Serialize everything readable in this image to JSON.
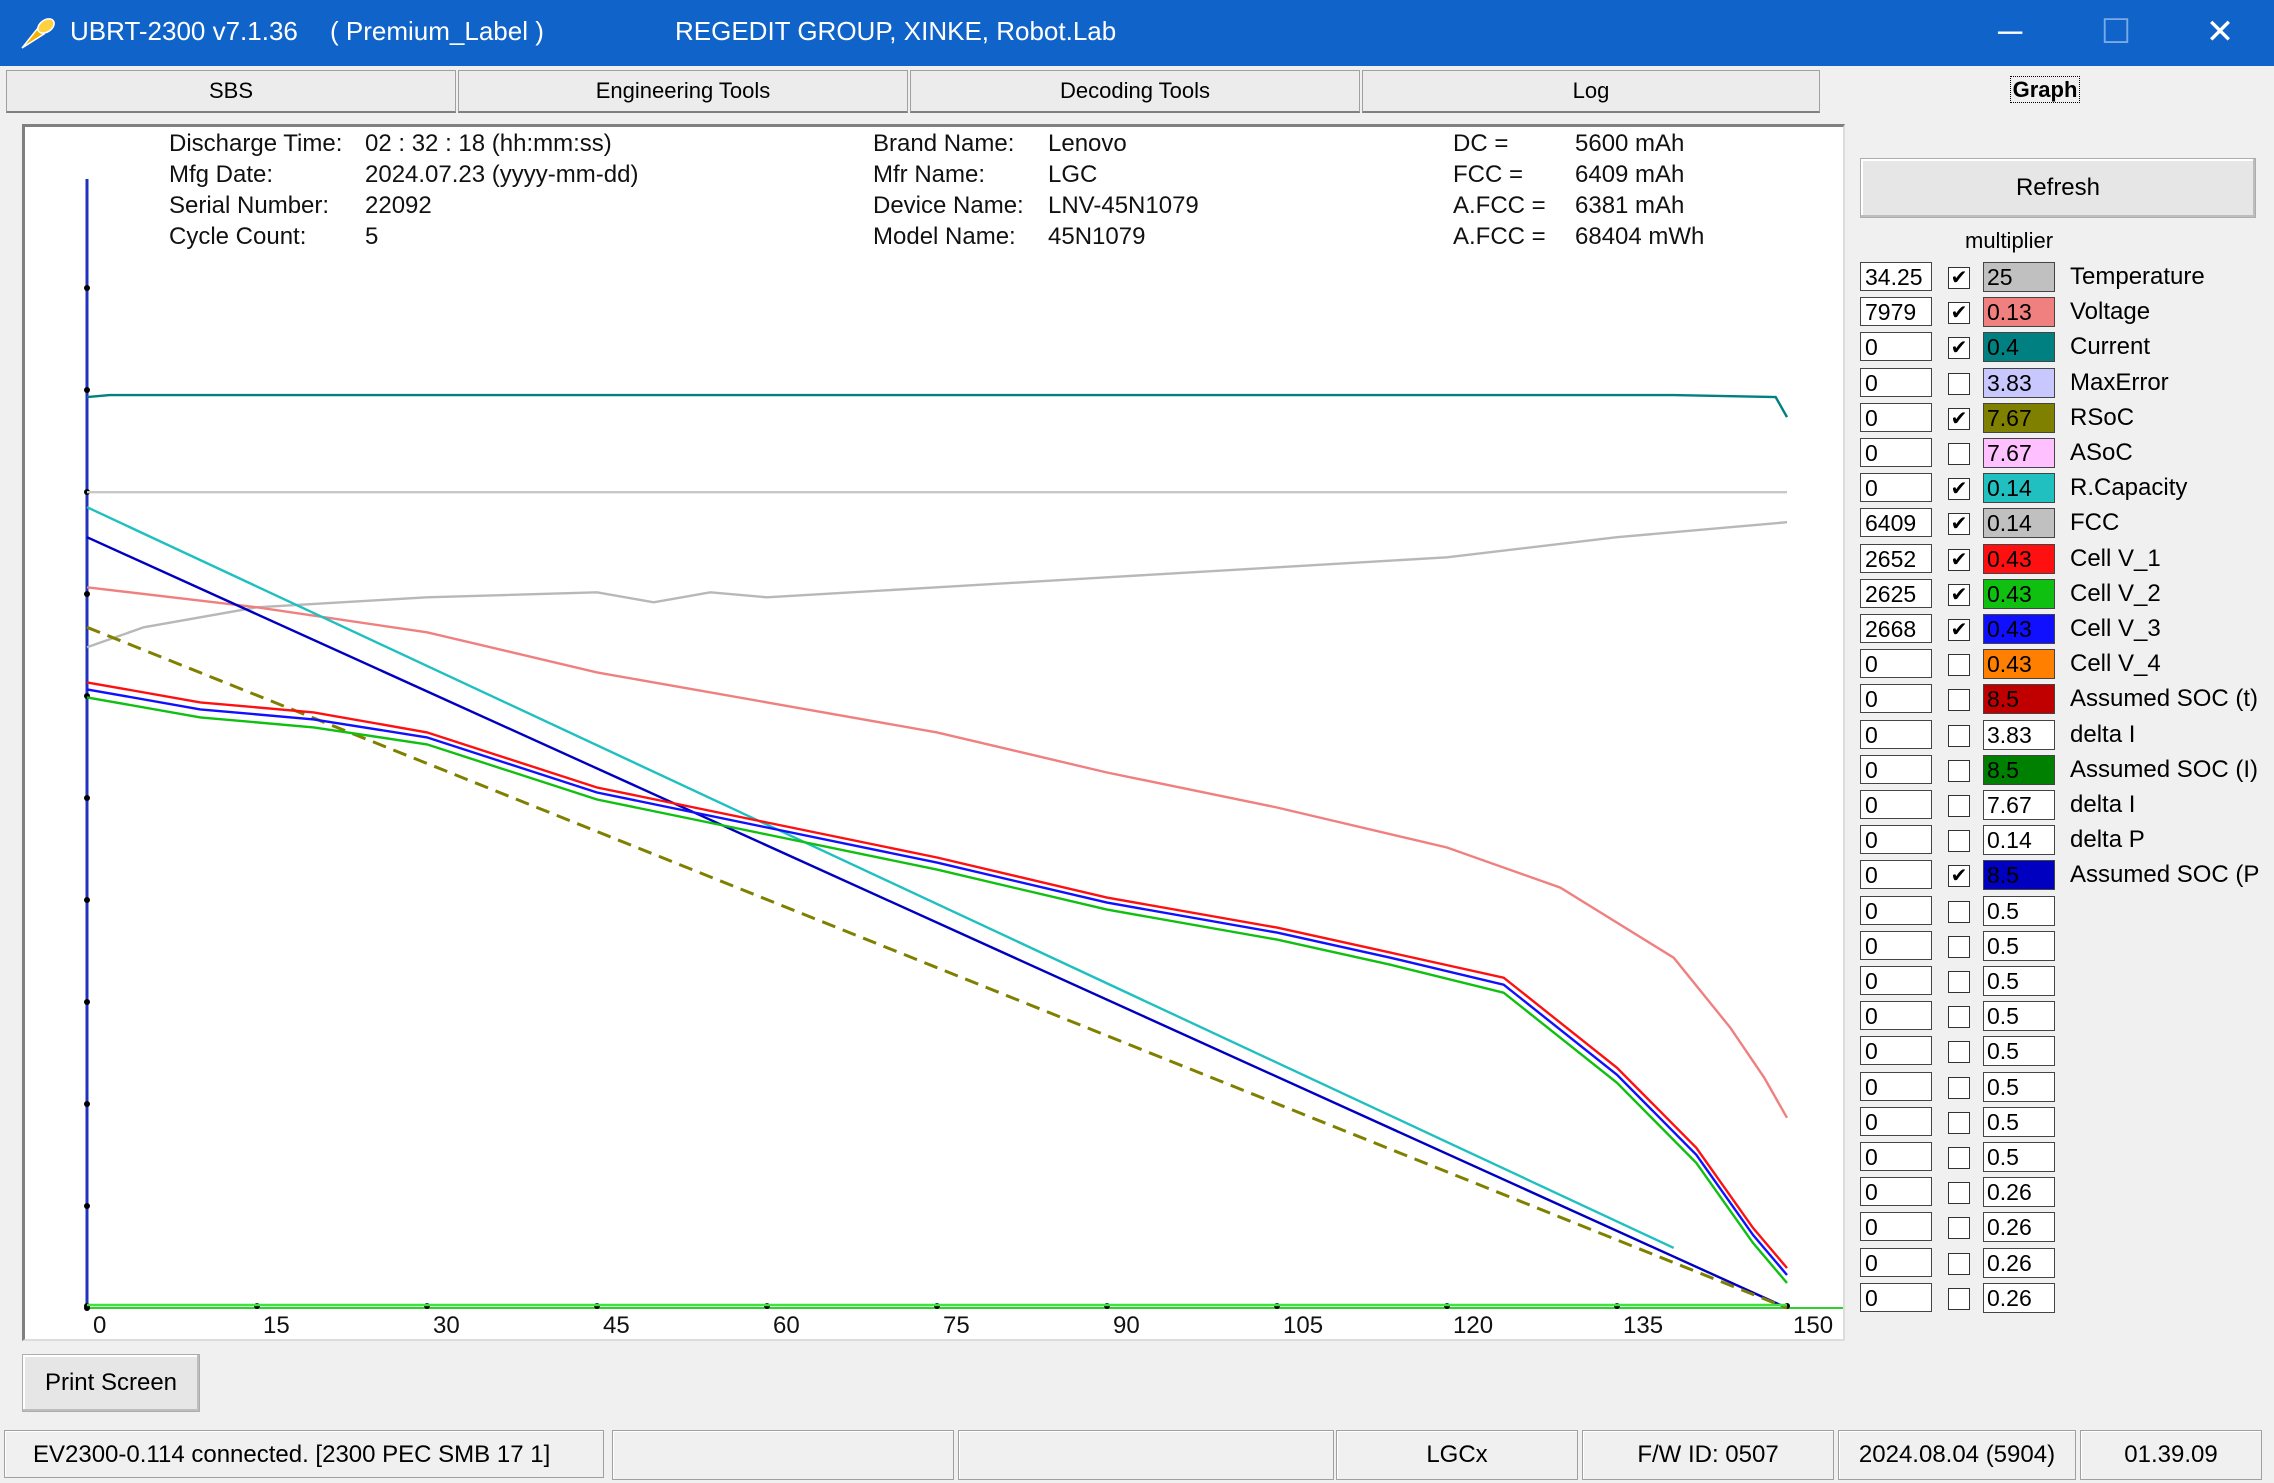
{
  "window": {
    "app_name": "UBRT-2300 v7.1.36",
    "label": "( Premium_Label )",
    "company": "REGEDIT GROUP,  XINKE,  Robot.Lab",
    "minimize": "─",
    "maximize": "☐",
    "close": "✕"
  },
  "tabs": [
    {
      "label": "SBS"
    },
    {
      "label": "Engineering Tools"
    },
    {
      "label": "Decoding Tools"
    },
    {
      "label": "Log"
    },
    {
      "label": "Graph"
    }
  ],
  "info": {
    "discharge_time_label": "Discharge Time:",
    "discharge_time_value": "02 : 32 : 18 (hh:mm:ss)",
    "mfg_date_label": "Mfg Date:",
    "mfg_date_value": "2024.07.23 (yyyy-mm-dd)",
    "serial_label": "Serial Number:",
    "serial_value": "22092",
    "cycle_label": "Cycle Count:",
    "cycle_value": "5",
    "brand_label": "Brand Name:",
    "brand_value": "Lenovo",
    "mfr_label": "Mfr Name:",
    "mfr_value": "LGC",
    "device_label": "Device Name:",
    "device_value": "LNV-45N1079",
    "model_label": "Model Name:",
    "model_value": "45N1079",
    "dc_label": "DC =",
    "dc_value": "5600 mAh",
    "fcc_label": "FCC =",
    "fcc_value": "6409 mAh",
    "afcc_label": "A.FCC =",
    "afcc_value": "6381 mAh",
    "afcc2_label": "A.FCC =",
    "afcc2_value": "68404 mWh"
  },
  "x_ticks": [
    "0",
    "15",
    "30",
    "45",
    "60",
    "75",
    "90",
    "105",
    "120",
    "135",
    "150"
  ],
  "buttons": {
    "refresh": "Refresh",
    "print_screen": "Print Screen"
  },
  "multiplier_label": "multiplier",
  "channels": [
    {
      "value": "34.25",
      "checked": true,
      "multiplier": "25",
      "color": "#c0c0c0",
      "name": "Temperature"
    },
    {
      "value": "7979",
      "checked": true,
      "multiplier": "0.13",
      "color": "#f08080",
      "name": "Voltage"
    },
    {
      "value": "0",
      "checked": true,
      "multiplier": "0.4",
      "color": "#008080",
      "name": "Current"
    },
    {
      "value": "0",
      "checked": false,
      "multiplier": "3.83",
      "color": "#c8c8ff",
      "name": "MaxError"
    },
    {
      "value": "0",
      "checked": true,
      "multiplier": "7.67",
      "color": "#808000",
      "name": "RSoC"
    },
    {
      "value": "0",
      "checked": false,
      "multiplier": "7.67",
      "color": "#ffc0ff",
      "name": "ASoC"
    },
    {
      "value": "0",
      "checked": true,
      "multiplier": "0.14",
      "color": "#20c0c0",
      "name": "R.Capacity"
    },
    {
      "value": "6409",
      "checked": true,
      "multiplier": "0.14",
      "color": "#c0c0c0",
      "name": "FCC"
    },
    {
      "value": "2652",
      "checked": true,
      "multiplier": "0.43",
      "color": "#ff1010",
      "name": "Cell V_1"
    },
    {
      "value": "2625",
      "checked": true,
      "multiplier": "0.43",
      "color": "#10c010",
      "name": "Cell V_2"
    },
    {
      "value": "2668",
      "checked": true,
      "multiplier": "0.43",
      "color": "#1010ff",
      "name": "Cell V_3"
    },
    {
      "value": "0",
      "checked": false,
      "multiplier": "0.43",
      "color": "#ff8000",
      "name": "Cell V_4"
    },
    {
      "value": "0",
      "checked": false,
      "multiplier": "8.5",
      "color": "#c00000",
      "name": "Assumed SOC (t)"
    },
    {
      "value": "0",
      "checked": false,
      "multiplier": "3.83",
      "color": "#ffffff",
      "name": "delta I"
    },
    {
      "value": "0",
      "checked": false,
      "multiplier": "8.5",
      "color": "#008000",
      "name": "Assumed SOC (I)"
    },
    {
      "value": "0",
      "checked": false,
      "multiplier": "7.67",
      "color": "#ffffff",
      "name": "delta I"
    },
    {
      "value": "0",
      "checked": false,
      "multiplier": "0.14",
      "color": "#ffffff",
      "name": "delta P"
    },
    {
      "value": "0",
      "checked": true,
      "multiplier": "8.5",
      "color": "#0000c0",
      "name": "Assumed SOC (P"
    },
    {
      "value": "0",
      "checked": false,
      "multiplier": "0.5",
      "color": "#ffffff",
      "name": ""
    },
    {
      "value": "0",
      "checked": false,
      "multiplier": "0.5",
      "color": "#ffffff",
      "name": ""
    },
    {
      "value": "0",
      "checked": false,
      "multiplier": "0.5",
      "color": "#ffffff",
      "name": ""
    },
    {
      "value": "0",
      "checked": false,
      "multiplier": "0.5",
      "color": "#ffffff",
      "name": ""
    },
    {
      "value": "0",
      "checked": false,
      "multiplier": "0.5",
      "color": "#ffffff",
      "name": ""
    },
    {
      "value": "0",
      "checked": false,
      "multiplier": "0.5",
      "color": "#ffffff",
      "name": ""
    },
    {
      "value": "0",
      "checked": false,
      "multiplier": "0.5",
      "color": "#ffffff",
      "name": ""
    },
    {
      "value": "0",
      "checked": false,
      "multiplier": "0.5",
      "color": "#ffffff",
      "name": ""
    },
    {
      "value": "0",
      "checked": false,
      "multiplier": "0.26",
      "color": "#ffffff",
      "name": ""
    },
    {
      "value": "0",
      "checked": false,
      "multiplier": "0.26",
      "color": "#ffffff",
      "name": ""
    },
    {
      "value": "0",
      "checked": false,
      "multiplier": "0.26",
      "color": "#ffffff",
      "name": ""
    },
    {
      "value": "0",
      "checked": false,
      "multiplier": "0.26",
      "color": "#ffffff",
      "name": ""
    }
  ],
  "status": {
    "connection": "EV2300-0.114 connected. [2300  PEC  SMB  17 1]",
    "empty1": "",
    "empty2": "",
    "chem": "LGCx",
    "fw": "F/W ID: 0507",
    "date": "2024.08.04  (5904)",
    "time": "01.39.09"
  },
  "chart_data": {
    "type": "line",
    "xlim": [
      0,
      150
    ],
    "ylim": [
      0,
      100
    ],
    "x_ticks": [
      0,
      15,
      30,
      45,
      60,
      75,
      90,
      105,
      120,
      135,
      150
    ],
    "series": [
      {
        "name": "Current",
        "color": "#008080",
        "x": [
          0,
          2,
          30,
          60,
          90,
          120,
          140,
          149,
          150
        ],
        "y": [
          91,
          91.2,
          91.2,
          91.2,
          91.2,
          91.2,
          91.2,
          91,
          89
        ]
      },
      {
        "name": "FCC",
        "color": "#c8c8c8",
        "x": [
          0,
          150
        ],
        "y": [
          81.5,
          81.5
        ]
      },
      {
        "name": "Temperature",
        "color": "#b8b8b8",
        "x": [
          0,
          5,
          15,
          30,
          45,
          50,
          55,
          60,
          75,
          90,
          105,
          120,
          135,
          145,
          150
        ],
        "y": [
          66,
          68,
          70,
          71,
          71.5,
          70.5,
          71.5,
          71,
          72,
          73,
          74,
          75,
          77,
          78,
          78.5
        ]
      },
      {
        "name": "Voltage",
        "color": "#f08080",
        "x": [
          0,
          15,
          30,
          45,
          60,
          75,
          90,
          105,
          120,
          130,
          140,
          145,
          148,
          150
        ],
        "y": [
          72,
          70,
          67.5,
          63.5,
          60.5,
          57.5,
          53.5,
          50,
          46,
          42,
          35,
          28,
          23,
          19
        ]
      },
      {
        "name": "R.Capacity",
        "color": "#20c0c0",
        "x": [
          0,
          140
        ],
        "y": [
          80,
          6
        ]
      },
      {
        "name": "Assumed SOC (P",
        "color": "#0000c0",
        "x": [
          0,
          150
        ],
        "y": [
          77,
          0
        ]
      },
      {
        "name": "RSoC",
        "color": "#808000",
        "x": [
          0,
          150
        ],
        "y": [
          68,
          0
        ]
      },
      {
        "name": "Cell V_1",
        "color": "#ff1010",
        "x": [
          0,
          10,
          20,
          30,
          45,
          60,
          75,
          90,
          105,
          115,
          125,
          135,
          142,
          147,
          150
        ],
        "y": [
          62.5,
          60.5,
          59.5,
          57.5,
          52,
          48.5,
          45,
          41,
          38,
          35.5,
          33,
          24,
          16,
          8,
          4
        ]
      },
      {
        "name": "Cell V_3",
        "color": "#1010ff",
        "x": [
          0,
          10,
          20,
          30,
          45,
          60,
          75,
          90,
          105,
          115,
          125,
          135,
          142,
          147,
          150
        ],
        "y": [
          61.8,
          59.8,
          58.8,
          57,
          51.5,
          48,
          44.5,
          40.5,
          37.5,
          35,
          32.3,
          23.3,
          15.3,
          7.3,
          3.3
        ]
      },
      {
        "name": "Cell V_2",
        "color": "#10c010",
        "x": [
          0,
          10,
          20,
          30,
          45,
          60,
          75,
          90,
          105,
          115,
          125,
          135,
          142,
          147,
          150
        ],
        "y": [
          61,
          59,
          58,
          56.3,
          50.8,
          47.3,
          43.8,
          39.8,
          36.8,
          34.3,
          31.5,
          22.5,
          14.5,
          6.5,
          2.5
        ]
      },
      {
        "name": "Cell V_4",
        "color": "#40e040",
        "x": [
          0,
          150
        ],
        "y": [
          0.3,
          0.3
        ]
      }
    ]
  }
}
